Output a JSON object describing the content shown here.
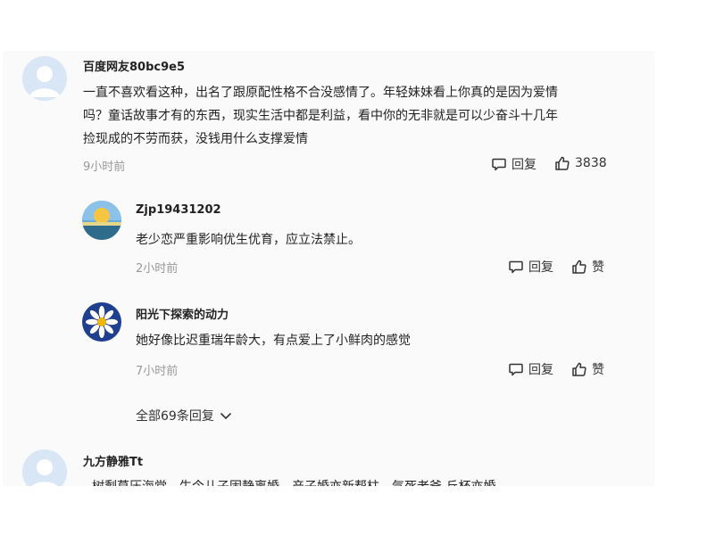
{
  "comments": [
    {
      "username": "百度网友80bc9e5",
      "line1": "一直不喜欢看这种，出名了跟原配性格不合没感情了。年轻妹妹看上你真的是因为爱情",
      "line2": "吗？童话故事才有的东西，现实生活中都是利益，看中你的无非就是可以少奋斗十几年",
      "line3": "捡现成的不劳而获，没钱用什么支撑爱情",
      "time": "9小时前",
      "reply_label": "回复",
      "like_label": "3838",
      "avatar_icon": "default-user-avatar"
    },
    {
      "username": "Zjp19431202",
      "line1": "老少恋严重影响优生优育，应立法禁止。",
      "time": "2小时前",
      "reply_label": "回复",
      "like_label": "赞",
      "avatar_icon": "sunset-landscape-avatar"
    },
    {
      "username": "阳光下探索的动力",
      "line1": "她好像比迟重瑞年龄大，有点爱上了小鲜肉的感觉",
      "time": "7小时前",
      "reply_label": "回复",
      "like_label": "赞",
      "avatar_icon": "daisy-flower-avatar"
    },
    {
      "username": "九方静雅Tt",
      "line1": "树剩草压海党，生今儿子固静离婚，产子婚亦新帮柱，气死老爸 丘杯亦婚",
      "avatar_icon": "default-user-avatar"
    }
  ],
  "expand_replies": {
    "label": "全部69条回复"
  },
  "colors": {
    "panel_bg": "#fafafa",
    "time_text": "#999999",
    "avatar_default": "#cfe0f5"
  }
}
